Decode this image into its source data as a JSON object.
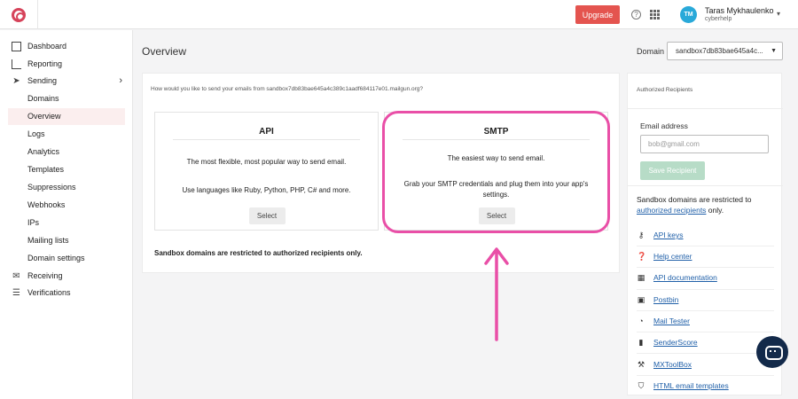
{
  "header": {
    "upgrade_label": "Upgrade",
    "help_glyph": "?",
    "user": {
      "initials": "TM",
      "name": "Taras Mykhaulenko",
      "org": "cyberhelp"
    },
    "brand_color": "#d6435a",
    "upgrade_color": "#e4544f"
  },
  "sidebar": {
    "items": [
      {
        "label": "Dashboard",
        "icon": "dashboard-icon"
      },
      {
        "label": "Reporting",
        "icon": "reporting-icon"
      },
      {
        "label": "Sending",
        "icon": "send-icon",
        "expanded": true
      },
      {
        "label": "Domains"
      },
      {
        "label": "Overview",
        "active": true
      },
      {
        "label": "Logs"
      },
      {
        "label": "Analytics"
      },
      {
        "label": "Templates"
      },
      {
        "label": "Suppressions"
      },
      {
        "label": "Webhooks"
      },
      {
        "label": "IPs"
      },
      {
        "label": "Mailing lists"
      },
      {
        "label": "Domain settings"
      },
      {
        "label": "Receiving",
        "icon": "mail-icon"
      },
      {
        "label": "Verifications",
        "icon": "list-check-icon"
      }
    ]
  },
  "main": {
    "title": "Overview",
    "domain_label": "Domain",
    "domain_value": "sandbox7db83bae645a4c...",
    "prompt": "How would you like to send your emails from sandbox7db83bae645a4c389c1aadf684117e01.mailgun.org?",
    "api": {
      "title": "API",
      "line1": "The most flexible, most popular way to send email.",
      "line2": "Use languages like Ruby, Python, PHP, C# and more.",
      "button": "Select"
    },
    "smtp": {
      "title": "SMTP",
      "line1": "The easiest way to send email.",
      "line2": "Grab your SMTP credentials and plug them into your app's settings.",
      "button": "Select"
    },
    "restrict_note": "Sandbox domains are restricted to authorized recipients only.",
    "highlight_color": "#e94fa7"
  },
  "right_panel": {
    "title": "Authorized Recipients",
    "email_label": "Email address",
    "email_placeholder": "bob@gmail.com",
    "save_label": "Save Recipient",
    "note_prefix": "Sandbox domains are restricted to ",
    "note_link": "authorized recipients",
    "note_suffix": " only.",
    "resources": [
      {
        "label": "API keys",
        "icon": "key-icon"
      },
      {
        "label": "Help center",
        "icon": "question-circle-icon"
      },
      {
        "label": "API documentation",
        "icon": "blocks-icon"
      },
      {
        "label": "Postbin",
        "icon": "inbox-icon"
      },
      {
        "label": "Mail Tester",
        "icon": "signal-icon"
      },
      {
        "label": "SenderScore",
        "icon": "bar-chart-icon"
      },
      {
        "label": "MXToolBox",
        "icon": "toolbox-icon"
      },
      {
        "label": "HTML email templates",
        "icon": "html5-icon"
      }
    ]
  }
}
